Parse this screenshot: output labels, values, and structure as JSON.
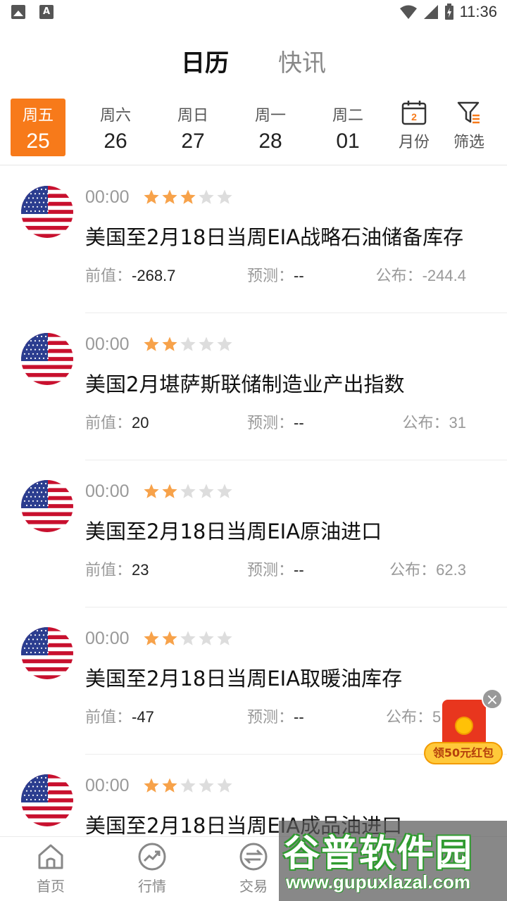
{
  "status_bar": {
    "time": "11:36"
  },
  "top_tabs": [
    {
      "label": "日历",
      "active": true
    },
    {
      "label": "快讯",
      "active": false
    }
  ],
  "date_strip": {
    "days": [
      {
        "weekday": "周五",
        "date": "25",
        "active": true
      },
      {
        "weekday": "周六",
        "date": "26",
        "active": false
      },
      {
        "weekday": "周日",
        "date": "27",
        "active": false
      },
      {
        "weekday": "周一",
        "date": "28",
        "active": false
      },
      {
        "weekday": "周二",
        "date": "01",
        "active": false
      }
    ],
    "month_button": {
      "label": "月份",
      "icon_number": "2"
    },
    "filter_button": {
      "label": "筛选"
    }
  },
  "events": [
    {
      "time": "00:00",
      "importance": 3,
      "title": "美国至2月18日当周EIA战略石油储备库存",
      "prev_label": "前值：",
      "prev": "-268.7",
      "forecast_label": "预测：",
      "forecast": "--",
      "actual_label": "公布：",
      "actual": "-244.4"
    },
    {
      "time": "00:00",
      "importance": 2,
      "title": "美国2月堪萨斯联储制造业产出指数",
      "prev_label": "前值：",
      "prev": "20",
      "forecast_label": "预测：",
      "forecast": "--",
      "actual_label": "公布：",
      "actual": "31"
    },
    {
      "time": "00:00",
      "importance": 2,
      "title": "美国至2月18日当周EIA原油进口",
      "prev_label": "前值：",
      "prev": "23",
      "forecast_label": "预测：",
      "forecast": "--",
      "actual_label": "公布：",
      "actual": "62.3"
    },
    {
      "time": "00:00",
      "importance": 2,
      "title": "美国至2月18日当周EIA取暖油库存",
      "prev_label": "前值：",
      "prev": "-47",
      "forecast_label": "预测：",
      "forecast": "--",
      "actual_label": "公布：",
      "actual": "5"
    },
    {
      "time": "00:00",
      "importance": 2,
      "title": "美国至2月18日当周EIA成品油进口"
    }
  ],
  "red_packet": {
    "label": "领50元红包"
  },
  "bottom_nav": [
    {
      "label": "首页",
      "icon": "home-icon"
    },
    {
      "label": "行情",
      "icon": "trend-icon"
    },
    {
      "label": "交易",
      "icon": "exchange-icon"
    }
  ],
  "watermark": {
    "main": "谷普软件园",
    "url": "www.gupuxlazal.com"
  },
  "colors": {
    "accent": "#f77a1a",
    "star_on": "#f7a24a",
    "star_off": "#dddddd",
    "red_packet": "#e8361e"
  }
}
